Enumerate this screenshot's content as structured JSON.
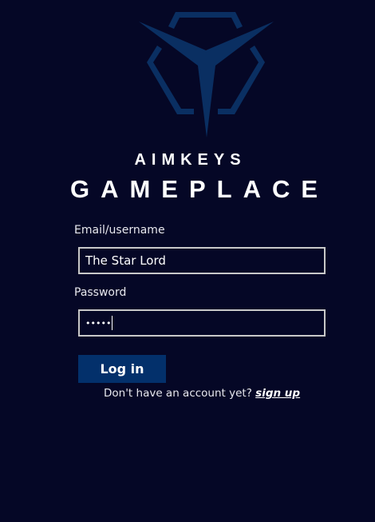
{
  "brand": {
    "line1": "AIMKEYS",
    "line2": "GAMEPLACE",
    "logo": "aimkeys-trident-logo",
    "colors": {
      "top": "#17c3b2",
      "bottom": "#0a3a6a"
    }
  },
  "form": {
    "email_label": "Email/username",
    "email_value": "The Star Lord",
    "password_label": "Password",
    "password_mask": "•••••",
    "login_label": "Log in",
    "signup_prompt": "Don't have an account yet?",
    "signup_link": "sign up"
  },
  "colors": {
    "background": "#050726",
    "button": "#03306b"
  }
}
